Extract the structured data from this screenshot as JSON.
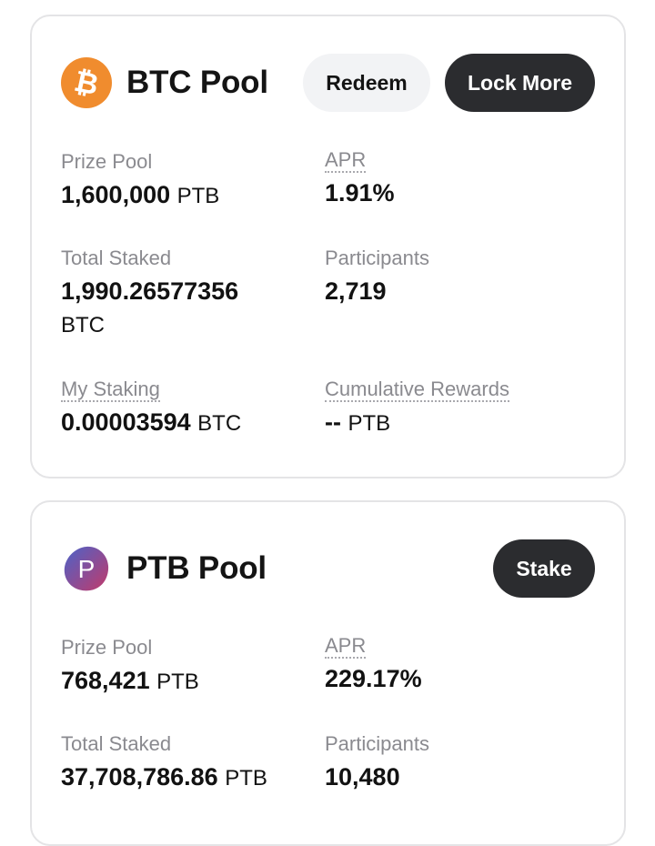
{
  "btc_pool": {
    "title": "BTC Pool",
    "icon": "bitcoin-icon",
    "icon_color": "#f08c2e",
    "redeem_label": "Redeem",
    "lock_more_label": "Lock More",
    "prize_pool": {
      "label": "Prize Pool",
      "value": "1,600,000",
      "unit": "PTB"
    },
    "apr": {
      "label": "APR",
      "value": "1.91%"
    },
    "total_staked": {
      "label": "Total Staked",
      "value": "1,990.26577356",
      "unit": "BTC"
    },
    "participants": {
      "label": "Participants",
      "value": "2,719"
    },
    "my_staking": {
      "label": "My Staking",
      "value": "0.00003594",
      "unit": "BTC"
    },
    "cumulative_rewards": {
      "label": "Cumulative Rewards",
      "value": "--",
      "unit": "PTB"
    }
  },
  "ptb_pool": {
    "title": "PTB Pool",
    "icon": "ptb-token-icon",
    "icon_gradient": [
      "#4b63c9",
      "#c23a6a"
    ],
    "stake_label": "Stake",
    "prize_pool": {
      "label": "Prize Pool",
      "value": "768,421",
      "unit": "PTB"
    },
    "apr": {
      "label": "APR",
      "value": "229.17%"
    },
    "total_staked": {
      "label": "Total Staked",
      "value": "37,708,786.86",
      "unit": "PTB"
    },
    "participants": {
      "label": "Participants",
      "value": "10,480"
    }
  }
}
